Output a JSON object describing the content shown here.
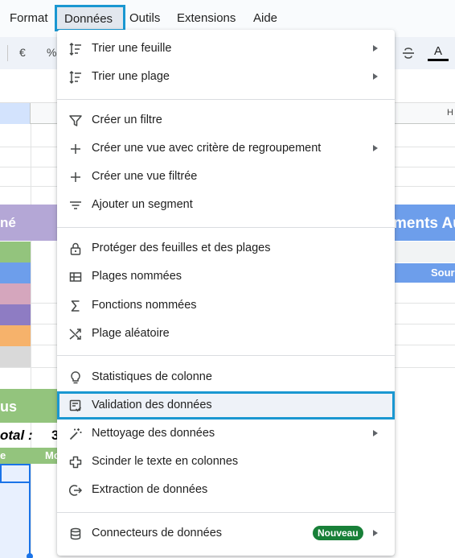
{
  "menubar": {
    "items": [
      "Format",
      "Données",
      "Outils",
      "Extensions",
      "Aide"
    ],
    "active": "Données"
  },
  "toolbar": {
    "currency": "€",
    "percent": "%",
    "text_color_letter": "A"
  },
  "grid": {
    "column_header_right": "H",
    "left_section_title_fragment": "né",
    "left_section2_title_fragment": "us",
    "total_label": "otal :",
    "total_value_fragment": "3",
    "green_row_left": "e",
    "green_row_mid": "Mo",
    "right_section_title_fragment": "ments Au",
    "right_bar_label_fragment": "Sour",
    "swatch_colors": [
      "#93c47d",
      "#6d9eeb",
      "#d5a6bd",
      "#8e7cc3",
      "#f6b26b",
      "#d9d9d9"
    ]
  },
  "menu": {
    "items": [
      {
        "label": "Trier une feuille",
        "icon": "sort-sheet-icon",
        "submenu": true
      },
      {
        "label": "Trier une plage",
        "icon": "sort-range-icon",
        "submenu": true
      },
      {
        "label": "Créer un filtre",
        "icon": "filter-icon",
        "submenu": false
      },
      {
        "label": "Créer une vue avec critère de regroupement",
        "icon": "plus-icon",
        "submenu": true
      },
      {
        "label": "Créer une vue filtrée",
        "icon": "plus-icon",
        "submenu": false
      },
      {
        "label": "Ajouter un segment",
        "icon": "slicer-icon",
        "submenu": false
      },
      {
        "label": "Protéger des feuilles et des plages",
        "icon": "lock-icon",
        "submenu": false
      },
      {
        "label": "Plages nommées",
        "icon": "named-ranges-icon",
        "submenu": false
      },
      {
        "label": "Fonctions nommées",
        "icon": "sigma-icon",
        "submenu": false
      },
      {
        "label": "Plage aléatoire",
        "icon": "shuffle-icon",
        "submenu": false
      },
      {
        "label": "Statistiques de colonne",
        "icon": "lightbulb-icon",
        "submenu": false
      },
      {
        "label": "Validation des données",
        "icon": "data-validation-icon",
        "submenu": false,
        "highlighted": true
      },
      {
        "label": "Nettoyage des données",
        "icon": "magic-wand-icon",
        "submenu": true
      },
      {
        "label": "Scinder le texte en colonnes",
        "icon": "split-columns-icon",
        "submenu": false
      },
      {
        "label": "Extraction de données",
        "icon": "extract-icon",
        "submenu": false
      },
      {
        "label": "Connecteurs de données",
        "icon": "database-icon",
        "submenu": true,
        "badge": "Nouveau"
      }
    ]
  },
  "colors": {
    "highlight_outline": "#1a97d1",
    "badge_green": "#188038",
    "selection_blue": "#1a73e8"
  }
}
